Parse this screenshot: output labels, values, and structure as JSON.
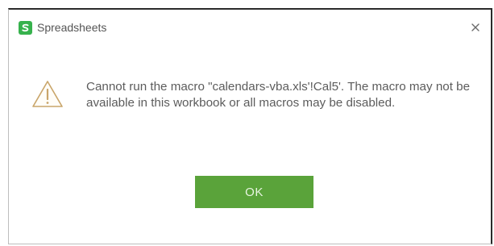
{
  "dialog": {
    "title": "Spreadsheets",
    "close_symbol": "×",
    "app_icon": "spreadsheets-logo-icon",
    "warning_icon": "warning-triangle-icon",
    "message": "Cannot run the macro \"calendars-vba.xls'!Cal5'. The macro may not be available in this workbook or all macros may be disabled.",
    "ok_label": "OK"
  },
  "colors": {
    "accent_green": "#5aa33a",
    "logo_green": "#37b24d",
    "warning_stroke": "#c9a56a"
  }
}
